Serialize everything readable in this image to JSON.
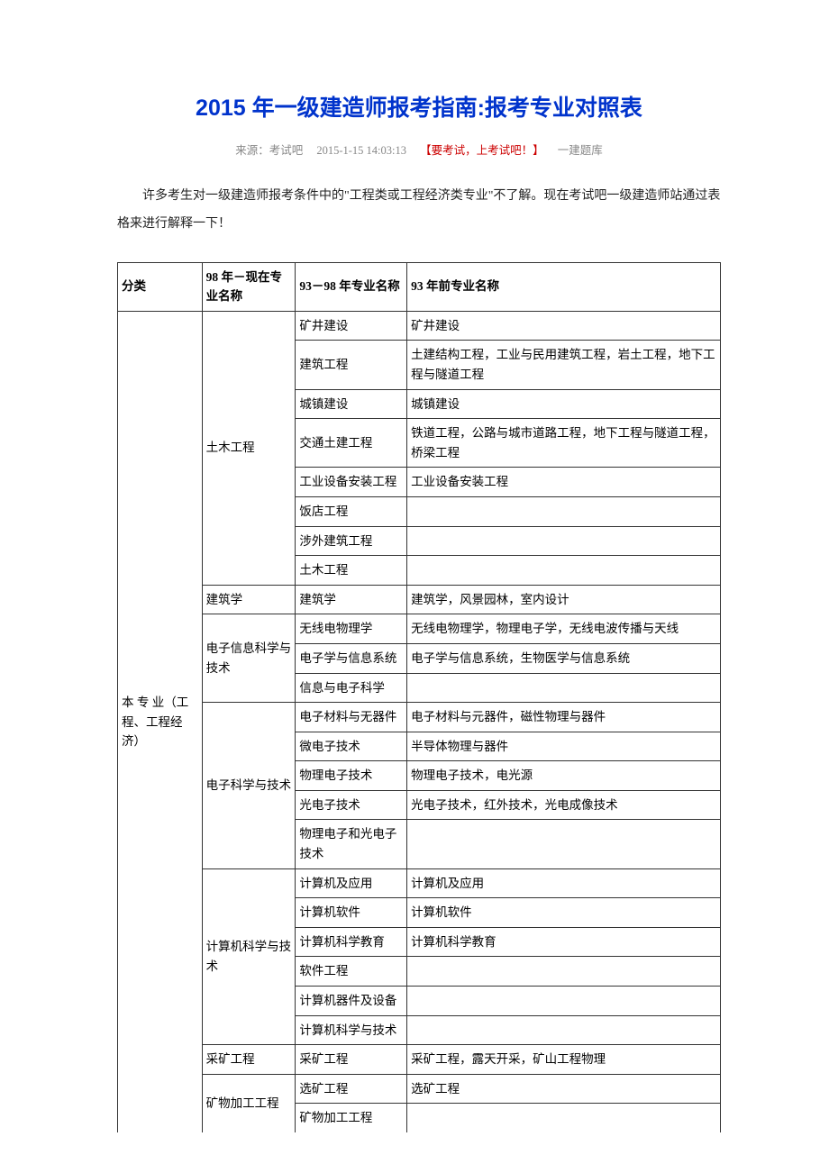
{
  "title": "2015 年一级建造师报考指南:报考专业对照表",
  "meta": {
    "source_label": "来源：考试吧",
    "datetime": "2015-1-15 14:03:13",
    "highlight": "【要考试，上考试吧！】",
    "extra": "一建题库"
  },
  "intro": "许多考生对一级建造师报考条件中的\"工程类或工程经济类专业\"不了解。现在考试吧一级建造师站通过表格来进行解释一下！",
  "headers": {
    "col1": "分类",
    "col2": "98 年－现在专业名称",
    "col3": "93－98 年专业名称",
    "col4": "93 年前专业名称"
  },
  "category": "本 专 业（工程、工程经济）",
  "majors": {
    "tumu": "土木工程",
    "jianzhuxue": "建筑学",
    "dianzixinxi": "电子信息科学与技术",
    "dianzikx": "电子科学与技术",
    "jisuanji": "计算机科学与技术",
    "caikuang": "采矿工程",
    "kuangwu": "矿物加工工程"
  },
  "rows": {
    "r1": {
      "c3": "矿井建设",
      "c4": "矿井建设"
    },
    "r2": {
      "c3": "建筑工程",
      "c4": "土建结构工程，工业与民用建筑工程，岩土工程，地下工程与隧道工程"
    },
    "r3": {
      "c3": "城镇建设",
      "c4": "城镇建设"
    },
    "r4": {
      "c3": "交通土建工程",
      "c4": "铁道工程，公路与城市道路工程，地下工程与隧道工程，桥梁工程"
    },
    "r5": {
      "c3": "工业设备安装工程",
      "c4": "工业设备安装工程"
    },
    "r6": {
      "c3": "饭店工程",
      "c4": ""
    },
    "r7": {
      "c3": "涉外建筑工程",
      "c4": ""
    },
    "r8": {
      "c3": "土木工程",
      "c4": ""
    },
    "r9": {
      "c3": "建筑学",
      "c4": "建筑学，风景园林，室内设计"
    },
    "r10": {
      "c3": "无线电物理学",
      "c4": "无线电物理学，物理电子学，无线电波传播与天线"
    },
    "r11": {
      "c3": "电子学与信息系统",
      "c4": "电子学与信息系统，生物医学与信息系统"
    },
    "r12": {
      "c3": "信息与电子科学",
      "c4": ""
    },
    "r13": {
      "c3": "电子材料与无器件",
      "c4": "电子材料与元器件，磁性物理与器件"
    },
    "r14": {
      "c3": "微电子技术",
      "c4": "半导体物理与器件"
    },
    "r15": {
      "c3": "物理电子技术",
      "c4": "物理电子技术，电光源"
    },
    "r16": {
      "c3": "光电子技术",
      "c4": "光电子技术，红外技术，光电成像技术"
    },
    "r17": {
      "c3": "物理电子和光电子技术",
      "c4": ""
    },
    "r18": {
      "c3": "计算机及应用",
      "c4": "计算机及应用"
    },
    "r19": {
      "c3": "计算机软件",
      "c4": "计算机软件"
    },
    "r20": {
      "c3": "计算机科学教育",
      "c4": "计算机科学教育"
    },
    "r21": {
      "c3": "软件工程",
      "c4": ""
    },
    "r22": {
      "c3": "计算机器件及设备",
      "c4": ""
    },
    "r23": {
      "c3": "计算机科学与技术",
      "c4": ""
    },
    "r24": {
      "c3": "采矿工程",
      "c4": "采矿工程，露天开采，矿山工程物理"
    },
    "r25": {
      "c3": "选矿工程",
      "c4": "选矿工程"
    },
    "r26": {
      "c3": "矿物加工工程",
      "c4": ""
    }
  }
}
